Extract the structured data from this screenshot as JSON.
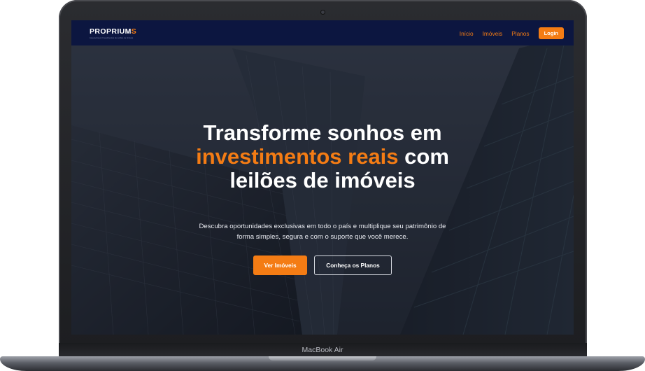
{
  "device": {
    "model_label": "MacBook Air"
  },
  "navbar": {
    "logo": {
      "brand_main": "PROPRIUM",
      "brand_accent": "S",
      "tagline": "Assessoria em Investimentos de Leilões de Imóveis"
    },
    "links": [
      {
        "label": "Início"
      },
      {
        "label": "Imóveis"
      },
      {
        "label": "Planos"
      }
    ],
    "login_label": "Login"
  },
  "hero": {
    "title_part1": "Transforme sonhos em ",
    "title_accent1": "investimentos reais",
    "title_part2": " com leilões de imóveis",
    "subtitle": "Descubra oportunidades exclusivas em todo o país e multiplique seu patrimônio de forma simples, segura e com o suporte que você merece.",
    "primary_cta": "Ver Imóveis",
    "secondary_cta": "Conheça os Planos"
  },
  "colors": {
    "accent": "#f47c14",
    "navbar_bg": "#0c1640",
    "overlay": "#141822"
  },
  "icons": {
    "camera": "webcam-dot"
  }
}
